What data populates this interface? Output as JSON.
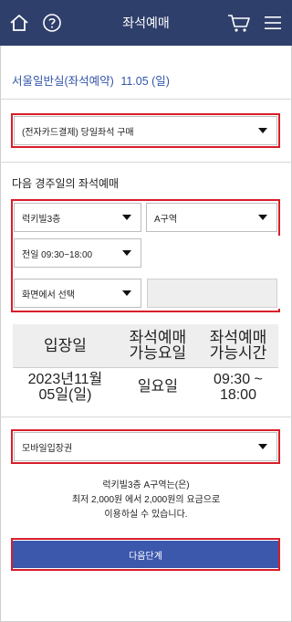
{
  "header": {
    "title": "좌석예매"
  },
  "icons": {
    "home": "home-icon",
    "help": "help-icon",
    "cart": "cart-icon",
    "menu": "menu-icon"
  },
  "venue": {
    "name": "서울일반실(좌석예약)",
    "date": "11.05 (일)"
  },
  "purchase_type": {
    "selected": "(전자카드결제) 당일좌석 구매"
  },
  "advance": {
    "title": "다음 경주일의 좌석예매",
    "floor": "럭키빌3층",
    "zone": "A구역",
    "time": "전일 09:30~18:00",
    "seat": "화면에서 선택"
  },
  "table": {
    "headers": [
      "입장일",
      "좌석예매\n가능요일",
      "좌석예매\n가능시간"
    ],
    "row": [
      "2023년11월\n05일(일)",
      "일요일",
      "09:30 ~\n18:00"
    ]
  },
  "ticket_type": {
    "selected": "모바일입장권"
  },
  "notice": {
    "line1": "럭키빌3층 A구역는(은)",
    "line2": "최저 2,000원 에서 2,000원의 요금으로",
    "line3": "이용하실 수 있습니다."
  },
  "next_button": {
    "label": "다음단계"
  },
  "colors": {
    "header_bg": "#2f3f6b",
    "venue_text": "#3355a8",
    "highlight": "#d71e2a",
    "button": "#3b58ad"
  }
}
